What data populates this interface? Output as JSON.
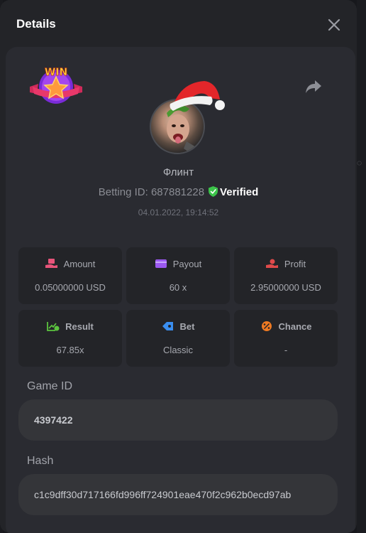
{
  "header": {
    "title": "Details",
    "close_icon": "close-icon"
  },
  "user": {
    "name": "Флинт",
    "betting_id_label": "Betting ID:",
    "betting_id": "687881228",
    "verified_label": "Verified",
    "datetime": "04.01.2022, 19:14:52"
  },
  "badge": {
    "text": "WIN"
  },
  "stats": [
    {
      "label": "Amount",
      "value": "0.05000000 USD",
      "icon": "money-hand-icon",
      "color": "#e8547a"
    },
    {
      "label": "Payout",
      "value": "60 x",
      "icon": "card-icon",
      "color": "#9b59f0"
    },
    {
      "label": "Profit",
      "value": "2.95000000 USD",
      "icon": "profit-hand-icon",
      "color": "#e04a4a"
    },
    {
      "label": "Result",
      "value": "67.85x",
      "icon": "chart-check-icon",
      "color": "#5cc43f"
    },
    {
      "label": "Bet",
      "value": "Classic",
      "icon": "tag-icon",
      "color": "#3a8ef0"
    },
    {
      "label": "Chance",
      "value": "-",
      "icon": "percent-icon",
      "color": "#ef7a22"
    }
  ],
  "fields": {
    "game_id_label": "Game ID",
    "game_id": "4397422",
    "hash_label": "Hash",
    "hash": "c1c9dff30d717166fd996ff724901eae470f2c962b0ecd97ab"
  },
  "colors": {
    "verified_shield": "#3cc44a",
    "background": "#232428",
    "card": "#2a2b31"
  }
}
